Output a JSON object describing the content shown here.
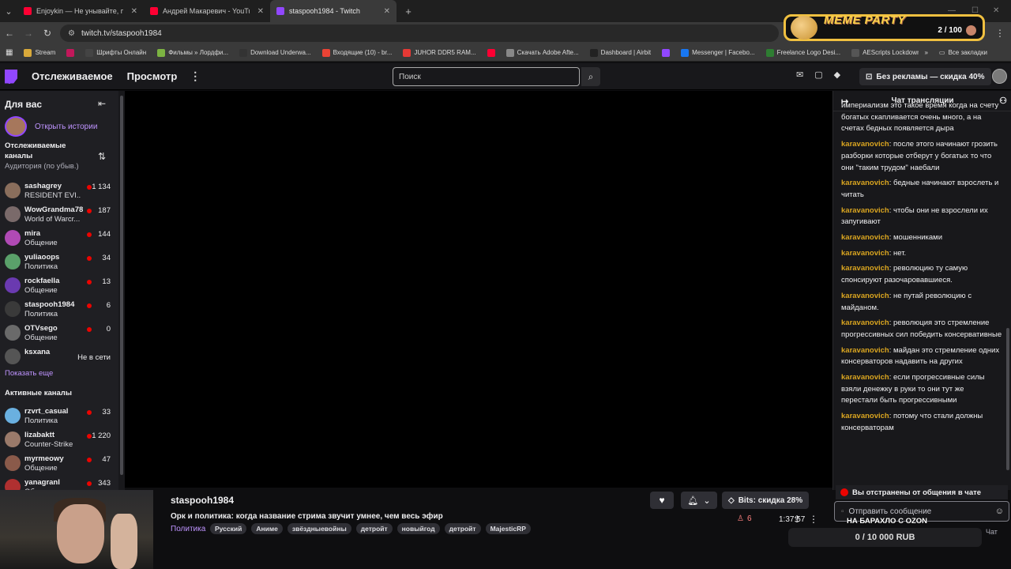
{
  "browser": {
    "tabs": [
      {
        "title": "Enjoykin — Не унывайте, пац...",
        "favicon_color": "#ff0033",
        "active": false
      },
      {
        "title": "Андрей Макаревич - YouTube",
        "favicon_color": "#ff0033",
        "active": false
      },
      {
        "title": "staspooh1984 - Twitch",
        "favicon_color": "#9147ff",
        "active": true
      }
    ],
    "new_tab": "+",
    "url": "twitch.tv/staspooh1984",
    "bookmarks": [
      {
        "label": "Stream",
        "color": "#d9a93a"
      },
      {
        "label": "",
        "color": "#c2185b"
      },
      {
        "label": "Шрифты Онлайн",
        "color": "#444444"
      },
      {
        "label": "Фильмы » Лордфи...",
        "color": "#7cb342"
      },
      {
        "label": "Download Underwa...",
        "color": "#333333"
      },
      {
        "label": "Входящие (10) - br...",
        "color": "#ea4335"
      },
      {
        "label": "JUHOR DDR5 RAM...",
        "color": "#e53935"
      },
      {
        "label": "",
        "color": "#ff0033"
      },
      {
        "label": "Скачать Adobe Afte...",
        "color": "#888888"
      },
      {
        "label": "Dashboard | Airbit",
        "color": "#222222"
      },
      {
        "label": "",
        "color": "#9147ff"
      },
      {
        "label": "Messenger | Facebo...",
        "color": "#1877f2"
      },
      {
        "label": "Freelance Logo Desi...",
        "color": "#2e7d32"
      },
      {
        "label": "AEScripts Lockdown...",
        "color": "#555555"
      }
    ],
    "all_bookmarks": "Все закладки"
  },
  "overlay": {
    "meme_title": "MEME PARTY",
    "meme_count": "2 / 100",
    "baraholo": "НА БАРАХЛО С OZON",
    "rub_goal": "0 / 10 000 RUB"
  },
  "twitch_nav": {
    "following": "Отслеживаемое",
    "browse": "Просмотр",
    "search_placeholder": "Поиск",
    "noads": "Без рекламы — скидка 40%"
  },
  "sidebar": {
    "for_you": "Для вас",
    "stories": "Открыть истории",
    "followed_head": "Отслеживаемые каналы",
    "followed_sub": "Аудитория (по убыв.)",
    "channels": [
      {
        "name": "sashagrey",
        "game": "RESIDENT EVI...",
        "viewers": "1 134",
        "color": "#8a6e5c"
      },
      {
        "name": "WowGrandma78",
        "game": "World of Warcr...",
        "viewers": "187",
        "color": "#7a6a6a"
      },
      {
        "name": "mira",
        "game": "Общение",
        "viewers": "144",
        "color": "#b04ab5"
      },
      {
        "name": "yuliaoops",
        "game": "Политика",
        "viewers": "34",
        "color": "#5aa06a"
      },
      {
        "name": "rockfaella",
        "game": "Общение",
        "viewers": "13",
        "color": "#6a3ab0"
      },
      {
        "name": "staspooh1984",
        "game": "Политика",
        "viewers": "6",
        "color": "#3a3a3a"
      },
      {
        "name": "OTVsego",
        "game": "Общение",
        "viewers": "0",
        "color": "#6a6a6a"
      },
      {
        "name": "ksxana",
        "game": "",
        "viewers": "Не в сети",
        "color": "#555555",
        "offline": true
      }
    ],
    "show_more": "Показать еще",
    "active_head": "Активные каналы",
    "active_channels": [
      {
        "name": "rzvrt_casual",
        "game": "Политика",
        "viewers": "33",
        "color": "#6ab0e0"
      },
      {
        "name": "lizabaktt",
        "game": "Counter-Strike",
        "viewers": "1 220",
        "color": "#9a7a6a"
      },
      {
        "name": "myrmeowy",
        "game": "Общение",
        "viewers": "47",
        "color": "#8a5a4a"
      },
      {
        "name": "yanagranl",
        "game": "Общение",
        "viewers": "343",
        "color": "#b03030"
      }
    ]
  },
  "stream": {
    "name": "staspooh1984",
    "title": "Орк и политика: когда название стрима звучит умнее, чем весь эфир",
    "category": "Политика",
    "tags": [
      "Русский",
      "Аниме",
      "звёздныевойны",
      "детройт",
      "новыйгод",
      "детройт",
      "MajesticRP"
    ],
    "bits": "Bits: скидка 28%",
    "viewers": "6",
    "uptime": "1:37:57"
  },
  "chat": {
    "title": "Чат трансляции",
    "messages": [
      {
        "user": "",
        "text": "империализм это такое время когда на счету богатых скапливается очень много, а на счетах бедных появляется дыра"
      },
      {
        "user": "karavanovich",
        "text": "после этого начинают грозить разборки которые отберут у богатых то что они \"таким трудом\" наебали"
      },
      {
        "user": "karavanovich",
        "text": "бедные начинают взрослеть и читать"
      },
      {
        "user": "karavanovich",
        "text": "чтобы они не взрослели их запугивают"
      },
      {
        "user": "karavanovich",
        "text": "мошенниками"
      },
      {
        "user": "karavanovich",
        "text": "нет."
      },
      {
        "user": "karavanovich",
        "text": "революцию ту самую спонсируют разочаровавшиеся."
      },
      {
        "user": "karavanovich",
        "text": "не путай революцию с майданом."
      },
      {
        "user": "karavanovich",
        "text": "революция это стремление прогрессивных сил победить консервативные"
      },
      {
        "user": "karavanovich",
        "text": "майдан это стремление одних консерваторов надавить на других"
      },
      {
        "user": "karavanovich",
        "text": "если прогрессивные силы взяли денежку в руки то они тут же перестали быть прогрессивными"
      },
      {
        "user": "karavanovich",
        "text": "потому что стали должны консерваторам"
      }
    ],
    "banned": "Вы отстранены от общения в чате",
    "input_placeholder": "Отправить сообщение",
    "chat_label": "Чат"
  }
}
